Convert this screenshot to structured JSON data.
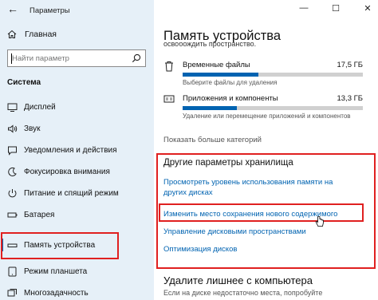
{
  "window": {
    "title": "Параметры",
    "back_glyph": "←",
    "minimize_glyph": "—",
    "maximize_glyph": "☐",
    "close_glyph": "✕"
  },
  "sidebar": {
    "home_label": "Главная",
    "search_placeholder": "Найти параметр",
    "section_label": "Система",
    "items": [
      {
        "label": "Дисплей",
        "icon": "display-icon"
      },
      {
        "label": "Звук",
        "icon": "sound-icon"
      },
      {
        "label": "Уведомления и действия",
        "icon": "notifications-icon"
      },
      {
        "label": "Фокусировка внимания",
        "icon": "focus-icon"
      },
      {
        "label": "Питание и спящий режим",
        "icon": "power-icon"
      },
      {
        "label": "Батарея",
        "icon": "battery-icon"
      },
      {
        "label": "Память устройства",
        "icon": "storage-icon",
        "active": true
      },
      {
        "label": "Режим планшета",
        "icon": "tablet-icon"
      },
      {
        "label": "Многозадачность",
        "icon": "multitasking-icon"
      }
    ]
  },
  "main": {
    "title": "Память устройства",
    "cut_text": "освобождить пространство.",
    "storage": [
      {
        "name": "Временные файлы",
        "size": "17,5 ГБ",
        "fill": 0.42,
        "desc": "Выберите файлы для удаления"
      },
      {
        "name": "Приложения и компоненты",
        "size": "13,3 ГБ",
        "fill": 0.3,
        "desc": "Удаление или перемещение приложений и компонентов"
      }
    ],
    "show_more": "Показать больше категорий",
    "other_title": "Другие параметры хранилища",
    "links": [
      "Просмотреть уровень использования памяти на других дисках",
      "Изменить место сохранения нового содержимого",
      "Управление дисковыми пространствами",
      "Оптимизация дисков"
    ],
    "delete_title": "Удалите лишнее с компьютера",
    "delete_sub": "Если на диске недостаточно места, попробуйте"
  },
  "colors": {
    "accent": "#0063b1",
    "highlight": "#e02020",
    "sidebar_bg": "#e6f0f8"
  }
}
